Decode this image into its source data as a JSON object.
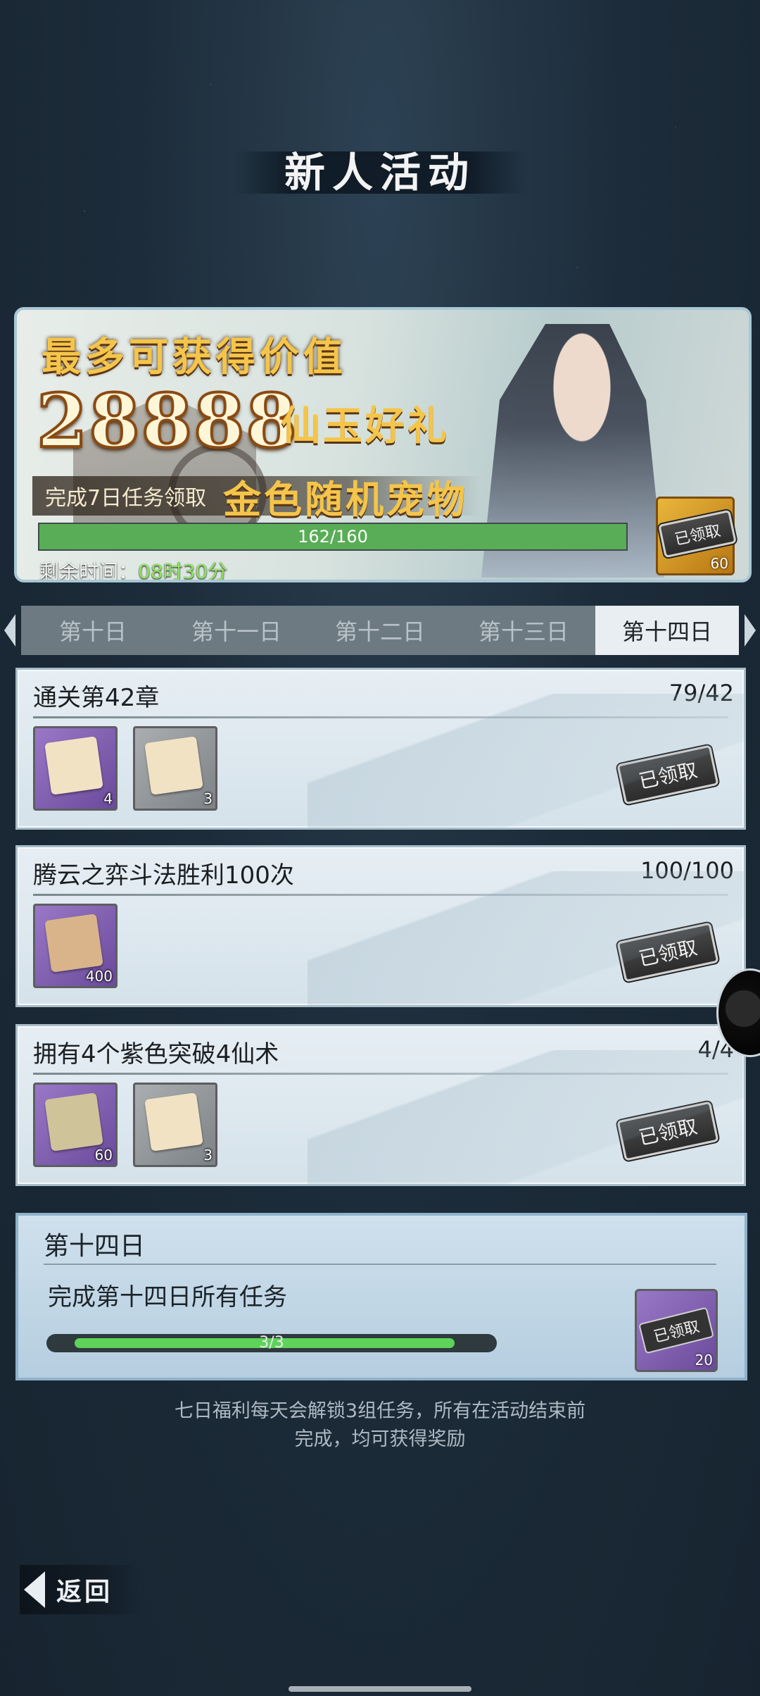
{
  "page": {
    "title": "新人活动"
  },
  "banner": {
    "headline": "最多可获得价值",
    "big_number": "28888",
    "big_number_label": "仙玉好礼",
    "sub_text": "完成7日任务领取",
    "sub_highlight": "金色随机宠物",
    "progress_label": "162/160",
    "progress_fraction": 1.0,
    "timer_label": "剩余时间：",
    "timer_value": "08时30分",
    "grand_reward": {
      "status": "已领取",
      "qty": "60"
    }
  },
  "tabs": [
    {
      "label": "第十日",
      "active": false
    },
    {
      "label": "第十一日",
      "active": false
    },
    {
      "label": "第十二日",
      "active": false
    },
    {
      "label": "第十三日",
      "active": false
    },
    {
      "label": "第十四日",
      "active": true
    }
  ],
  "tasks": [
    {
      "name": "通关第42章",
      "count": "79/42",
      "status": "已领取",
      "rewards": [
        {
          "qty": "4",
          "rarity": "purple"
        },
        {
          "qty": "3",
          "rarity": "gray"
        }
      ]
    },
    {
      "name": "腾云之弈斗法胜利100次",
      "count": "100/100",
      "status": "已领取",
      "rewards": [
        {
          "qty": "400",
          "rarity": "purple"
        }
      ]
    },
    {
      "name": "拥有4个紫色突破4仙术",
      "count": "4/4",
      "status": "已领取",
      "rewards": [
        {
          "qty": "60",
          "rarity": "purple"
        },
        {
          "qty": "3",
          "rarity": "gray"
        }
      ]
    }
  ],
  "day_summary": {
    "title": "第十四日",
    "task": "完成第十四日所有任务",
    "progress_label": "3/3",
    "reward": {
      "status": "已领取",
      "qty": "20"
    }
  },
  "note": {
    "line1": "七日福利每天会解锁3组任务，所有在活动结束前",
    "line2": "完成，均可获得奖励"
  },
  "back": {
    "label": "返回"
  },
  "colors": {
    "progress_green": "#59ad56",
    "timer_green": "#8ee35f",
    "gold_text": "#f4c54a"
  }
}
